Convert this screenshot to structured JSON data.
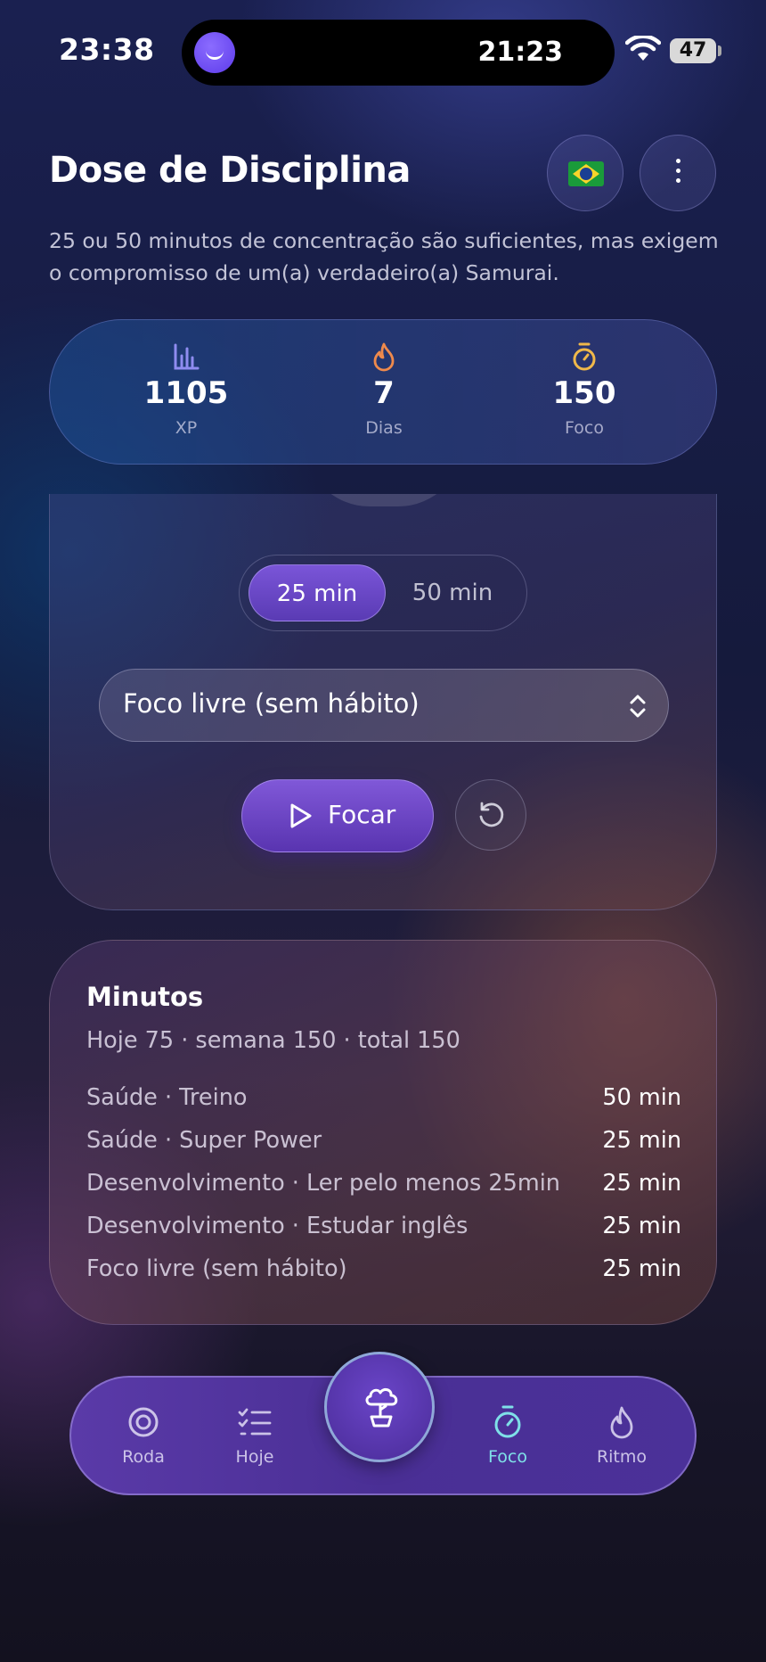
{
  "status": {
    "time": "23:38",
    "island_time": "21:23",
    "battery": "47"
  },
  "header": {
    "title": "Dose de Disciplina",
    "subtitle": "25 ou 50 minutos de concentração são suficientes, mas exigem o compromisso de um(a) verdadeiro(a) Samurai."
  },
  "stats": [
    {
      "icon": "bar-chart-icon",
      "value": "1105",
      "label": "XP",
      "color": "#8f8cf0"
    },
    {
      "icon": "flame-icon",
      "value": "7",
      "label": "Dias",
      "color": "#ef8a4c"
    },
    {
      "icon": "stopwatch-icon",
      "value": "150",
      "label": "Foco",
      "color": "#f0b84a"
    }
  ],
  "timer": {
    "durations": [
      "25 min",
      "50 min"
    ],
    "selected_duration": "25 min",
    "habit_select": "Foco livre (sem hábito)",
    "start_label": "Focar"
  },
  "minutes": {
    "title": "Minutos",
    "summary": "Hoje 75 · semana 150 · total 150",
    "rows": [
      {
        "name": "Saúde · Treino",
        "value": "50 min"
      },
      {
        "name": "Saúde · Super Power",
        "value": "25 min"
      },
      {
        "name": "Desenvolvimento · Ler pelo menos 25min",
        "value": "25 min"
      },
      {
        "name": "Desenvolvimento · Estudar inglês",
        "value": "25 min"
      },
      {
        "name": "Foco livre (sem hábito)",
        "value": "25 min"
      }
    ]
  },
  "nav": {
    "items": [
      {
        "label": "Roda",
        "icon": "target-icon"
      },
      {
        "label": "Hoje",
        "icon": "checklist-icon"
      },
      {
        "label": "Foco",
        "icon": "stopwatch-icon",
        "active": true
      },
      {
        "label": "Ritmo",
        "icon": "flame-icon"
      }
    ],
    "center_icon": "bonsai-tree-icon",
    "active_color": "#7fe0e8"
  }
}
